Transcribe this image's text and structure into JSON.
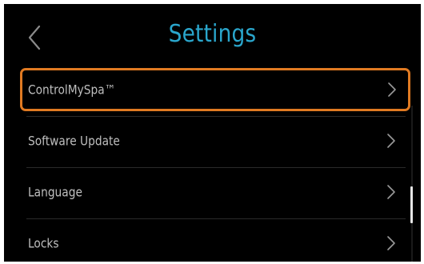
{
  "header": {
    "title": "Settings",
    "back_icon": "chevron-left-icon"
  },
  "menu": {
    "items": [
      {
        "label": "ControlMySpa™",
        "selected": true,
        "icon": "chevron-right-icon"
      },
      {
        "label": "Software Update",
        "selected": false,
        "icon": "chevron-right-icon"
      },
      {
        "label": "Language",
        "selected": false,
        "icon": "chevron-right-icon"
      },
      {
        "label": "Locks",
        "selected": false,
        "icon": "chevron-right-icon"
      }
    ]
  },
  "colors": {
    "background": "#000000",
    "title": "#2aa6cc",
    "item_text": "#bfbfbf",
    "selection_border": "#e07a22",
    "chevron": "#9a9a9a"
  }
}
